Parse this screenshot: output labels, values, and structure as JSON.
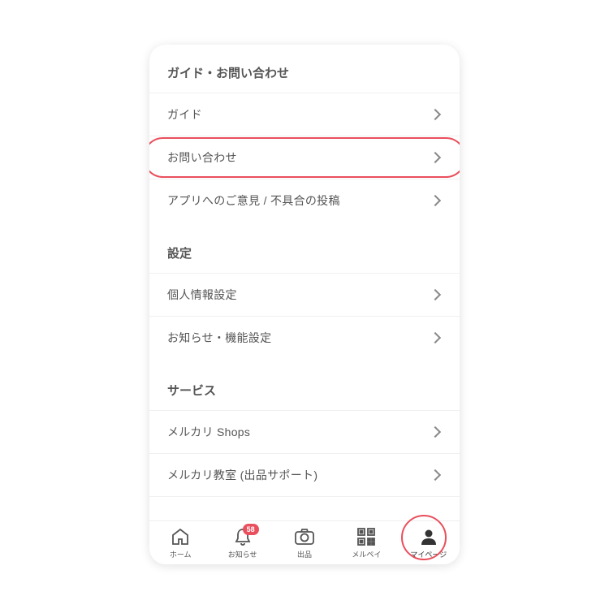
{
  "sections": [
    {
      "title": "ガイド・お問い合わせ",
      "items": [
        {
          "label": "ガイド"
        },
        {
          "label": "お問い合わせ",
          "highlighted": true
        },
        {
          "label": "アプリへのご意見 / 不具合の投稿"
        }
      ]
    },
    {
      "title": "設定",
      "items": [
        {
          "label": "個人情報設定"
        },
        {
          "label": "お知らせ・機能設定"
        }
      ]
    },
    {
      "title": "サービス",
      "items": [
        {
          "label": "メルカリ Shops"
        },
        {
          "label": "メルカリ教室 (出品サポート)"
        }
      ]
    }
  ],
  "nav": {
    "badge_count": "58",
    "items": [
      {
        "label": "ホーム"
      },
      {
        "label": "お知らせ"
      },
      {
        "label": "出品"
      },
      {
        "label": "メルペイ"
      },
      {
        "label": "マイページ"
      }
    ]
  }
}
